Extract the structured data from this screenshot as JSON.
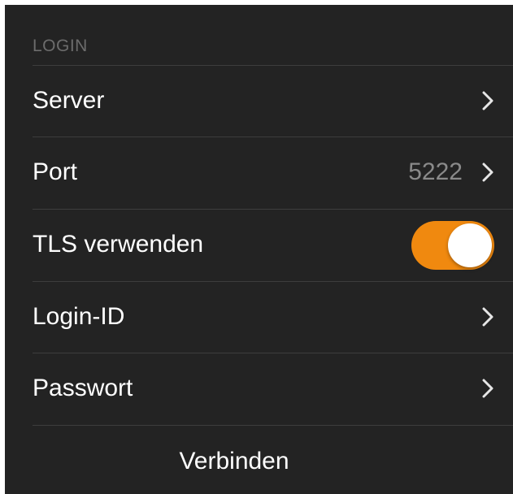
{
  "section": {
    "header": "LOGIN"
  },
  "rows": {
    "server": {
      "label": "Server"
    },
    "port": {
      "label": "Port",
      "value": "5222"
    },
    "tls": {
      "label": "TLS verwenden",
      "enabled": true
    },
    "login_id": {
      "label": "Login-ID"
    },
    "password": {
      "label": "Passwort"
    }
  },
  "actions": {
    "connect_label": "Verbinden"
  },
  "colors": {
    "background": "#232323",
    "separator": "#3d3d3d",
    "toggle_on": "#f0890f",
    "secondary_text": "#8a8a8a",
    "header_text": "#6c6c6c"
  },
  "icons": {
    "chevron": "chevron-right-icon"
  }
}
